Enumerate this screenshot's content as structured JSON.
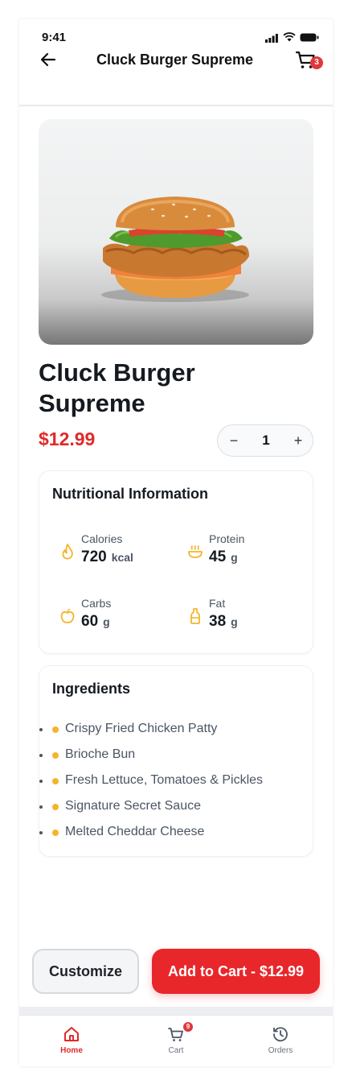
{
  "status_bar": {
    "time": "9:41"
  },
  "header": {
    "title": "Cluck Burger Supreme",
    "cart_badge": "3"
  },
  "product": {
    "name": "Cluck Burger Supreme",
    "price": "$12.99",
    "quantity": "1"
  },
  "nutrition": {
    "title": "Nutritional Information",
    "items": [
      {
        "label": "Calories",
        "value": "720",
        "unit": "kcal",
        "icon": "flame-icon"
      },
      {
        "label": "Protein",
        "value": "45",
        "unit": "g",
        "icon": "bowl-icon"
      },
      {
        "label": "Carbs",
        "value": "60",
        "unit": "g",
        "icon": "apple-icon"
      },
      {
        "label": "Fat",
        "value": "38",
        "unit": "g",
        "icon": "bottle-icon"
      }
    ]
  },
  "ingredients": {
    "title": "Ingredients",
    "items": [
      "Crispy Fried Chicken Patty",
      "Brioche Bun",
      "Fresh Lettuce, Tomatoes & Pickles",
      "Signature Secret Sauce",
      "Melted Cheddar Cheese"
    ]
  },
  "actions": {
    "customize": "Customize",
    "add_to_cart": "Add to Cart - $12.99"
  },
  "tabbar": {
    "tabs": [
      {
        "label": "Home",
        "icon": "home-icon",
        "active": true
      },
      {
        "label": "Cart",
        "icon": "cart-icon",
        "badge": "9"
      },
      {
        "label": "Orders",
        "icon": "history-icon"
      }
    ]
  },
  "colors": {
    "accent": "#e8272b",
    "price": "#e02a2a",
    "nutrition_icon": "#f5b42a"
  }
}
